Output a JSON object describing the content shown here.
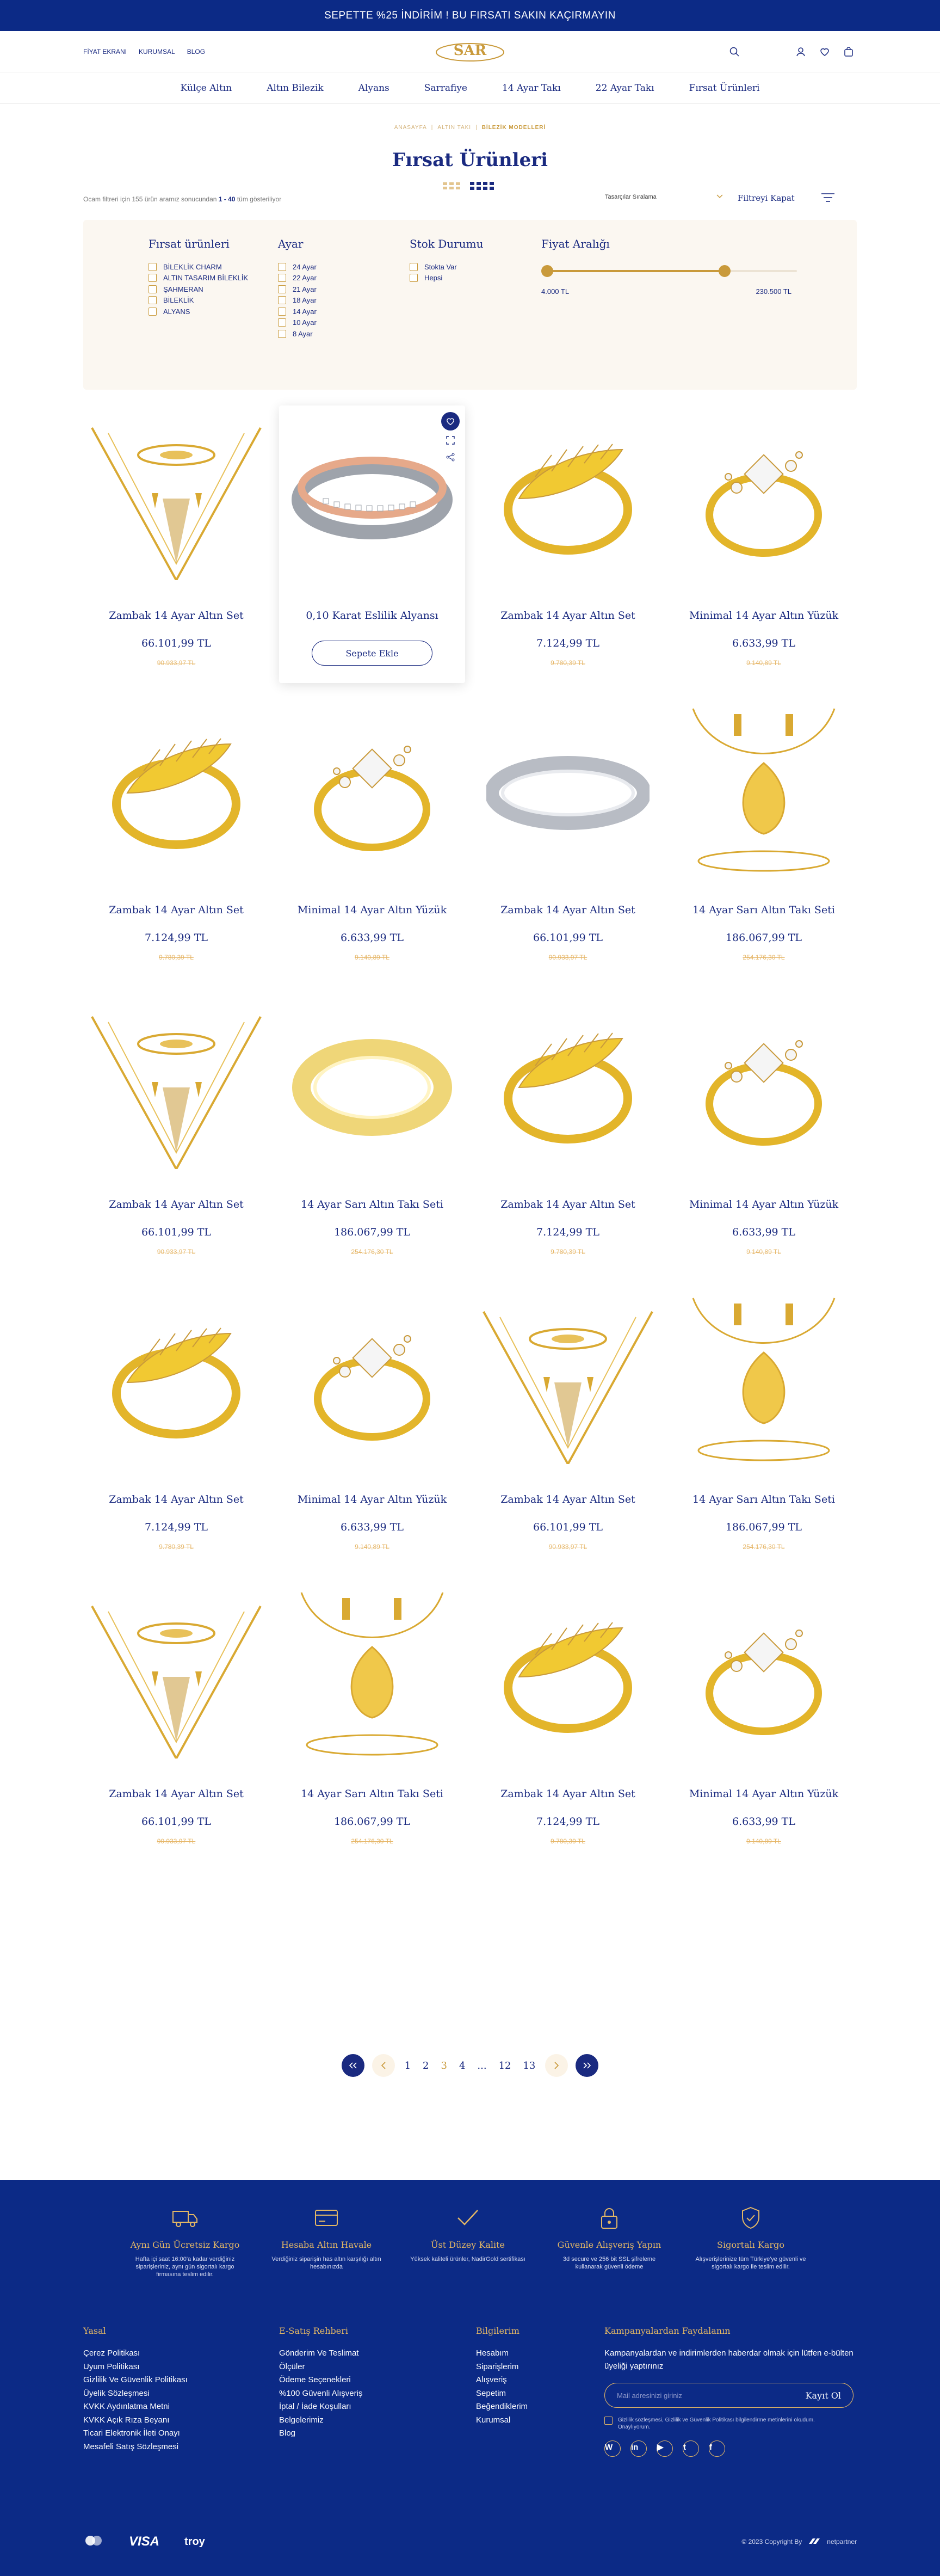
{
  "banner": {
    "text": "SEPETTE %25 İNDİRİM ! BU FIRSATI SAKIN KAÇIRMAYIN"
  },
  "header": {
    "links": [
      "FİYAT EKRANI",
      "KURUMSAL",
      "BLOG"
    ],
    "logo_text": "SAR"
  },
  "nav": [
    "Külçe Altın",
    "Altın Bilezik",
    "Alyans",
    "Sarrafiye",
    "14 Ayar Takı",
    "22 Ayar Takı",
    "Fırsat Ürünleri"
  ],
  "breadcrumb": [
    "ANASAYFA",
    "ALTIN TAKI",
    "BİLEZİK MODELLERİ"
  ],
  "page_title": "Fırsat Ürünleri",
  "toolbar": {
    "result_prefix": "Ocam filtreri için 155 ürün aramız sonucundan",
    "result_range": "1 - 40",
    "result_suffix": "tüm gösteriliyor",
    "sort_label": "Tasarçılar Sıralama",
    "filter_close": "Filtreyi Kapat"
  },
  "filters": {
    "category": {
      "title": "Fırsat ürünleri",
      "options": [
        "BİLEKLİK CHARM",
        "ALTIN TASARIM BİLEKLİK",
        "ŞAHMERAN",
        "BİLEKLİK",
        "ALYANS"
      ]
    },
    "karat": {
      "title": "Ayar",
      "options": [
        "24 Ayar",
        "22 Ayar",
        "21 Ayar",
        "18 Ayar",
        "14 Ayar",
        "10 Ayar",
        "8 Ayar"
      ]
    },
    "stock": {
      "title": "Stok Durumu",
      "options": [
        "Stokta Var",
        "Hepsi"
      ]
    },
    "price": {
      "title": "Fiyat Aralığı",
      "min": "4.000 TL",
      "max": "230.500 TL"
    }
  },
  "products": [
    {
      "name": "Zambak 14 Ayar Altın Set",
      "price": "66.101,99 TL",
      "old": "90.933,97 TL",
      "img": "necklace-set"
    },
    {
      "name": "0,10 Karat Eslilik Alyansı",
      "price": "",
      "old": "",
      "img": "wedding-band-twotone",
      "cta": "Sepete Ekle"
    },
    {
      "name": "Zambak 14 Ayar Altın Set",
      "price": "7.124,99 TL",
      "old": "9.780,39 TL",
      "img": "leaf-ring"
    },
    {
      "name": "Minimal 14 Ayar Altın Yüzük",
      "price": "6.633,99 TL",
      "old": "9.140,89 TL",
      "img": "stone-ring"
    },
    {
      "name": "Zambak 14 Ayar Altın Set",
      "price": "7.124,99 TL",
      "old": "9.780,39 TL",
      "img": "leaf-ring"
    },
    {
      "name": "Minimal 14 Ayar Altın Yüzük",
      "price": "6.633,99 TL",
      "old": "9.140,89 TL",
      "img": "stone-ring"
    },
    {
      "name": "Zambak 14 Ayar Altın Set",
      "price": "66.101,99 TL",
      "old": "90.933,97 TL",
      "img": "silver-band"
    },
    {
      "name": "14 Ayar Sarı Altın Takı Seti",
      "price": "186.067,99 TL",
      "old": "254.176,30 TL",
      "img": "drop-set"
    },
    {
      "name": "Zambak 14 Ayar Altın Set",
      "price": "66.101,99 TL",
      "old": "90.933,97 TL",
      "img": "necklace-set"
    },
    {
      "name": "14 Ayar Sarı Altın Takı Seti",
      "price": "186.067,99 TL",
      "old": "254.176,30 TL",
      "img": "gold-band"
    },
    {
      "name": "Zambak 14 Ayar Altın Set",
      "price": "7.124,99 TL",
      "old": "9.780,39 TL",
      "img": "leaf-ring"
    },
    {
      "name": "Minimal 14 Ayar Altın Yüzük",
      "price": "6.633,99 TL",
      "old": "9.140,89 TL",
      "img": "stone-ring"
    },
    {
      "name": "Zambak 14 Ayar Altın Set",
      "price": "7.124,99 TL",
      "old": "9.780,39 TL",
      "img": "leaf-ring"
    },
    {
      "name": "Minimal 14 Ayar Altın Yüzük",
      "price": "6.633,99 TL",
      "old": "9.140,89 TL",
      "img": "stone-ring"
    },
    {
      "name": "Zambak 14 Ayar Altın Set",
      "price": "66.101,99 TL",
      "old": "90.933,97 TL",
      "img": "necklace-set"
    },
    {
      "name": "14 Ayar Sarı Altın Takı Seti",
      "price": "186.067,99 TL",
      "old": "254.176,30 TL",
      "img": "drop-set"
    },
    {
      "name": "Zambak 14 Ayar Altın Set",
      "price": "66.101,99 TL",
      "old": "90.933,97 TL",
      "img": "necklace-set"
    },
    {
      "name": "14 Ayar Sarı Altın Takı Seti",
      "price": "186.067,99 TL",
      "old": "254.176,30 TL",
      "img": "drop-set"
    },
    {
      "name": "Zambak 14 Ayar Altın Set",
      "price": "7.124,99 TL",
      "old": "9.780,39 TL",
      "img": "leaf-ring"
    },
    {
      "name": "Minimal 14 Ayar Altın Yüzük",
      "price": "6.633,99 TL",
      "old": "9.140,89 TL",
      "img": "stone-ring"
    }
  ],
  "pagination": {
    "pages": [
      "1",
      "2",
      "3",
      "4",
      "...",
      "12",
      "13"
    ],
    "active": "3"
  },
  "footer": {
    "features": [
      {
        "title": "Aynı Gün Ücretsiz Kargo",
        "text": "Hafta içi saat 16:00'a kadar verdiğiniz siparişleriniz, aynı gün sigortalı kargo firmasına teslim edilir.",
        "icon": "truck-icon"
      },
      {
        "title": "Hesaba Altın Havale",
        "text": "Verdiğiniz siparişin has altın karşılığı altın hesabınızda",
        "icon": "card-icon"
      },
      {
        "title": "Üst Düzey Kalite",
        "text": "Yüksek kaliteli ürünler, NadirGold sertifikası",
        "icon": "check-icon"
      },
      {
        "title": "Güvenle Alışveriş Yapın",
        "text": "3d secure ve 256 bit SSL şifreleme kullanarak güvenli ödeme",
        "icon": "lock-icon"
      },
      {
        "title": "Sigortalı Kargo",
        "text": "Alışverişlerinize tüm Türkiye'ye güvenli ve sigortalı kargo ile teslim edilir.",
        "icon": "shield-icon"
      }
    ],
    "columns": [
      {
        "title": "Yasal",
        "links": [
          "Çerez Politikası",
          "Uyum Politikası",
          "Gizlilik Ve Güvenlik Politikası",
          "Üyelik Sözleşmesi",
          "KVKK Aydınlatma Metni",
          "KVKK Açık Rıza Beyanı",
          "Ticari Elektronik İleti Onayı",
          "Mesafeli Satış Sözleşmesi"
        ]
      },
      {
        "title": "E-Satış Rehberi",
        "links": [
          "Gönderim Ve Teslimat",
          "Ölçüler",
          "Ödeme Seçenekleri",
          "%100 Güvenli Alışveriş",
          "İptal / İade Koşulları",
          "Belgelerimiz",
          "Blog"
        ]
      },
      {
        "title": "Bilgilerim",
        "links": [
          "Hesabım",
          "Siparişlerim",
          "Alışveriş",
          "Sepetim",
          "Beğendiklerim",
          "Kurumsal"
        ]
      }
    ],
    "newsletter": {
      "title": "Kampanyalardan Faydalanın",
      "text": "Kampanyalardan ve indirimlerden haberdar olmak için lütfen e-bülten üyeliği yaptırınız",
      "placeholder": "Mail adresinizi giriniz",
      "button": "Kayıt Ol",
      "consent": "Gizlilik sözleşmesi, Gizlilik ve Güvenlik Politikası bilgilendirme metinlerini okudum. Onaylıyorum."
    },
    "socials": [
      "W",
      "in",
      "▶",
      "t",
      "f"
    ],
    "payments": [
      "VISA",
      "troy"
    ],
    "copyright": "© 2023 Copyright By",
    "agency": "netpartner"
  }
}
